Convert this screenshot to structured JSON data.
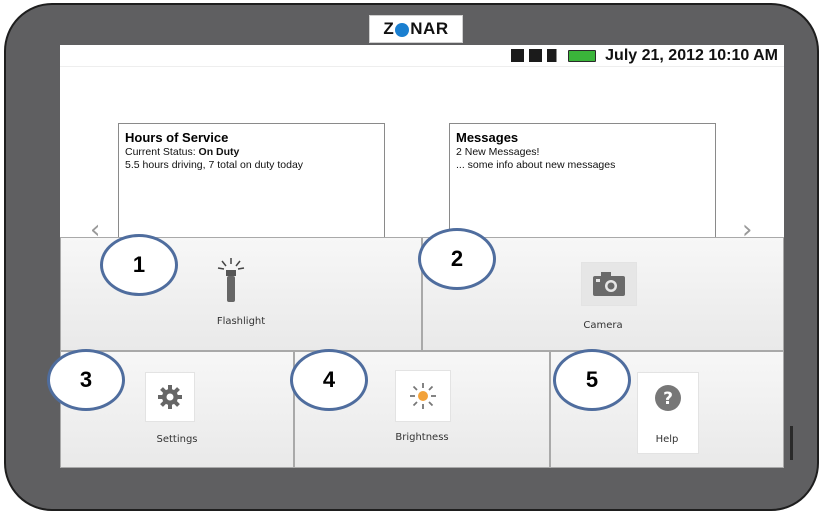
{
  "brand": {
    "logo_text": "ZONAR",
    "accent": "#1a7fd0"
  },
  "status_bar": {
    "icons": [
      "bluetooth-icon",
      "wifi-icon",
      "signal-icon",
      "battery-icon"
    ],
    "datetime": "July 21, 2012 10:10 AM"
  },
  "cards": [
    {
      "title": "Hours of Service",
      "status_prefix": "Current Status:",
      "status_value": "On Duty",
      "detail": "5.5 hours driving, 7 total on duty today"
    },
    {
      "title": "Messages",
      "line1": "2 New Messages!",
      "line2": "... some info about new messages"
    }
  ],
  "tiles": {
    "flashlight": "Flashlight",
    "camera": "Camera",
    "settings": "Settings",
    "brightness": "Brightness",
    "help": "Help"
  },
  "callouts": [
    "1",
    "2",
    "3",
    "4",
    "5"
  ],
  "colors": {
    "device_frame": "#5f5f61",
    "callout_border": "#4f6d9e",
    "battery": "#3ab53a"
  }
}
